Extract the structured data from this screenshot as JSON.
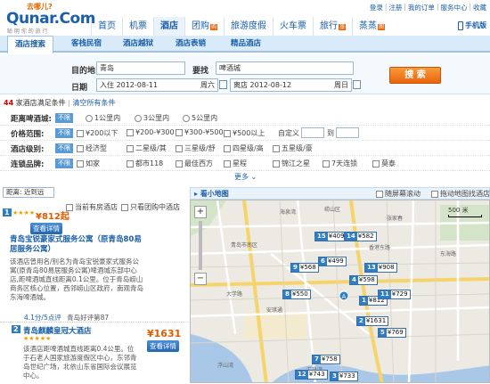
{
  "logo": {
    "top": "去哪儿?",
    "brand": "Qunar.Com",
    "slogan": "聪 明 你 的 旅 行"
  },
  "toplinks": [
    "登录",
    "注册",
    "我的订单",
    "服务中心",
    "收藏"
  ],
  "nav": [
    "首页",
    "机票",
    "酒店",
    "团购",
    "旅游度假",
    "火车票",
    "旅行",
    "蒸蒸"
  ],
  "nav_badges": {
    "tuan": "购",
    "lvxing": "旅",
    "zhenzhen": "图"
  },
  "nav_active": "酒店",
  "mobile": "手机版",
  "subnav": [
    "酒店搜索",
    "客栈民宿",
    "酒店越狱",
    "酒店表销",
    "精品酒店"
  ],
  "search": {
    "dest_label": "目的地",
    "dest_value": "青岛",
    "near_label": "要找",
    "near_value": "啤酒城",
    "date_label": "日期",
    "checkin": "入住 2012-08-11",
    "checkin_day": "周六",
    "checkout": "离店 2012-08-12",
    "checkout_day": "周日",
    "button": "搜 索"
  },
  "conditions": {
    "count": "44",
    "text": "家酒店满足条件",
    "clear": "清空所有条件"
  },
  "filters": {
    "distance": {
      "label": "距离啤酒城:",
      "options": [
        "不限",
        "1公里内",
        "3公里内",
        "5公里内"
      ]
    },
    "price": {
      "label": "价格范围:",
      "options": [
        "不限",
        "¥200以下",
        "¥200-¥300",
        "¥300-¥500",
        "¥500以上"
      ],
      "custom": "自定义",
      "to": "到"
    },
    "level": {
      "label": "酒店级别:",
      "options": [
        "不限",
        "经济型",
        "二星级/其",
        "三星级/舒",
        "四星级/高",
        "五星级/豪"
      ]
    },
    "chain": {
      "label": "连锁品牌:",
      "options": [
        "不限",
        "如家",
        "都市118",
        "最佳西方",
        "星程",
        "锦江之星",
        "7天连锁",
        "莫泰"
      ]
    }
  },
  "more": "更多",
  "sort": {
    "label": "距离: 近到远",
    "only_rooms": "当前有房酒店",
    "only_tuan": "只看团购中酒店"
  },
  "mapbar": {
    "title": "看小地图",
    "chk1": "随屏幕滚动",
    "chk2": "拖动地图找酒店"
  },
  "hotels": [
    {
      "num": "1",
      "stars": "★★★★",
      "price": "¥812起",
      "view": "查看详情",
      "name": "青岛宝锐豪家式服务公寓（原青岛80易居服务公寓）",
      "desc": "该酒店曾用名/别名为青岛宝锐豪家式服务公寓(原青岛80易居服务公寓)啤酒城东部中心店,距啤酒城直线距离0.1公里。位于青岛崂山商务区核心位置，西邻崂山区政府，南观青岛东海啤酒城。",
      "score": "4.1分/5点评",
      "review": "青岛好评第87"
    },
    {
      "num": "2",
      "stars": "★★★★★",
      "price": "¥1631起",
      "view": "查看详情",
      "name": "青岛麒麟皇冠大酒店",
      "desc": "该酒店距啤酒城直线距离0.4公里。位于石老人国家旅游度假区中心，东邻青岛世纪广场，北依山东省国际会议展览中心。"
    }
  ],
  "map_pins": [
    {
      "n": "15",
      "p": "¥409"
    },
    {
      "n": "14",
      "p": "¥582"
    },
    {
      "n": "6",
      "p": "¥499"
    },
    {
      "n": "9",
      "p": "¥568"
    },
    {
      "n": "13",
      "p": "¥908"
    },
    {
      "n": "8",
      "p": "¥550"
    },
    {
      "n": "1",
      "p": "¥812"
    },
    {
      "n": "11",
      "p": "¥729"
    },
    {
      "n": "4",
      "p": "¥598"
    },
    {
      "n": "2",
      "p": "¥1631"
    },
    {
      "n": "5",
      "p": "¥769"
    },
    {
      "n": "7",
      "p": "¥758"
    },
    {
      "n": "12",
      "p": "¥743"
    },
    {
      "n": "3",
      "p": "¥733"
    }
  ],
  "map_scale": "500 米",
  "map_labels": [
    "青岛市南区",
    "崂山区",
    "海泉湾",
    "香港东路",
    "银川路",
    "东海路",
    "安琪通",
    "福州路",
    "大学路",
    "南京路",
    "松岭路",
    "张家春",
    "钦州路",
    "苗岭路",
    "中韩",
    "麦岛",
    "太平角",
    "浮山湾",
    "汇泉湾"
  ],
  "colors": {
    "accent": "#1a5fa8",
    "orange": "#e8650c",
    "price": "#e25b00",
    "nav_bg": "#d9eaf8"
  }
}
